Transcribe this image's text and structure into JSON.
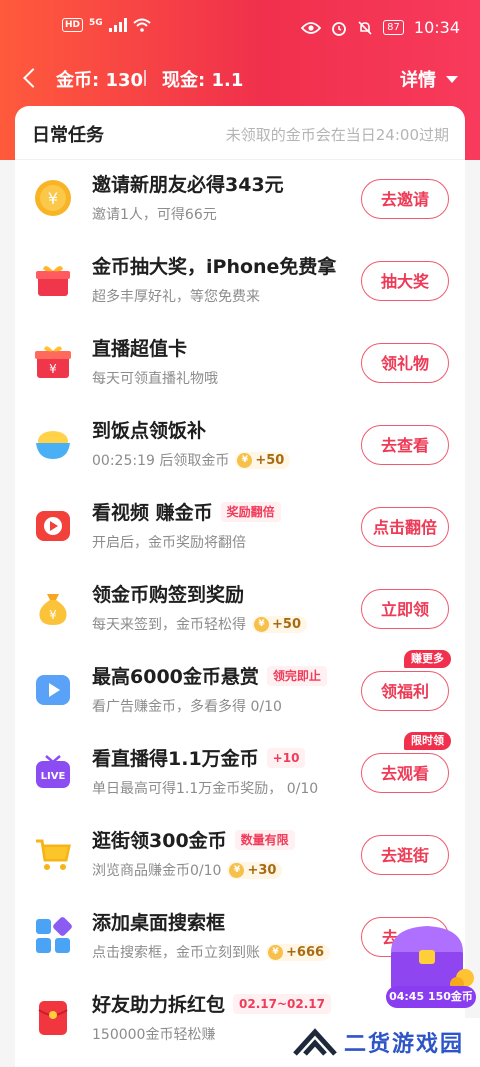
{
  "status_bar": {
    "hd": "HD",
    "net": "5G",
    "battery": "87",
    "time": "10:34"
  },
  "nav": {
    "gold": "金币: 130",
    "cash": "现金: 1.1",
    "detail": "详情"
  },
  "card": {
    "title": "日常任务",
    "note": "未领取的金币会在当日24:00过期"
  },
  "tasks": [
    {
      "icon": "coin-icon",
      "title": "邀请新朋友必得343元",
      "tag": "",
      "sub": "邀请1人，可得66元",
      "chip": "",
      "button": "去邀请",
      "bubble": ""
    },
    {
      "icon": "gift-box-icon",
      "title": "金币抽大奖，iPhone免费拿",
      "tag": "",
      "sub": "超多丰厚好礼，等您免费来",
      "chip": "",
      "button": "抽大奖",
      "bubble": ""
    },
    {
      "icon": "gift-card-icon",
      "title": "直播超值卡",
      "tag": "",
      "sub": "每天可领直播礼物哦",
      "chip": "",
      "button": "领礼物",
      "bubble": ""
    },
    {
      "icon": "rice-bowl-icon",
      "title": "到饭点领饭补",
      "tag": "",
      "sub": "00:25:19 后领取金币",
      "chip": "+50",
      "button": "去查看",
      "bubble": ""
    },
    {
      "icon": "video-play-icon",
      "title": "看视频 赚金币",
      "tag": "奖励翻倍",
      "sub": "开启后，金币奖励将翻倍",
      "chip": "",
      "button": "点击翻倍",
      "bubble": ""
    },
    {
      "icon": "money-bag-icon",
      "title": "领金币购签到奖励",
      "tag": "",
      "sub": "每天来签到，金币轻松得",
      "chip": "+50",
      "button": "立即领",
      "bubble": ""
    },
    {
      "icon": "ad-play-icon",
      "title": "最高6000金币悬赏",
      "tag": "领完即止",
      "sub": "看广告赚金币，多看多得 0/10",
      "chip": "",
      "button": "领福利",
      "bubble": "赚更多"
    },
    {
      "icon": "live-tv-icon",
      "title": "看直播得1.1万金币",
      "tag": "+10",
      "sub": "单日最高可得1.1万金币奖励， 0/10",
      "chip": "",
      "button": "去观看",
      "bubble": "限时领"
    },
    {
      "icon": "shopping-cart-icon",
      "title": "逛街领300金币",
      "tag": "数量有限",
      "sub": "浏览商品赚金币0/10",
      "chip": "+30",
      "button": "去逛街",
      "bubble": ""
    },
    {
      "icon": "app-grid-icon",
      "title": "添加桌面搜索框",
      "tag": "",
      "sub": "点击搜索框，金币立刻到账",
      "chip": "+666",
      "button": "去",
      "bubble": ""
    },
    {
      "icon": "red-packet-icon",
      "title": "好友助力拆红包",
      "tag": "02.17~02.17",
      "sub": "150000金币轻松赚",
      "chip": "",
      "button": "",
      "bubble": ""
    }
  ],
  "float": {
    "time": "04:45",
    "reward": "150金币"
  },
  "watermark": {
    "text": "二货游戏园"
  },
  "colors": {
    "brand": "#f0304c",
    "button_text": "#ee3a56",
    "chip_bg": "#fff6e5"
  }
}
